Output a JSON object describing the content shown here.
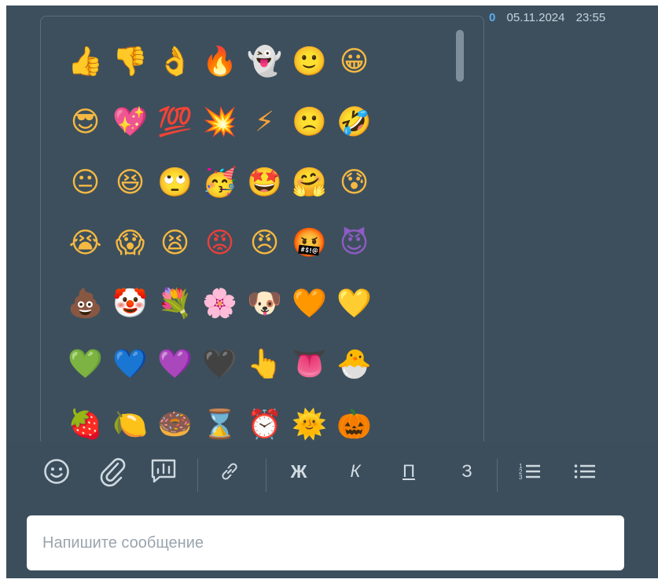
{
  "meta": {
    "count": "0",
    "date": "05.11.2024",
    "time": "23:55"
  },
  "picker": {
    "rows": [
      [
        {
          "name": "thumbs-up",
          "char": "👍",
          "color": "#f5b942"
        },
        {
          "name": "thumbs-down",
          "char": "👎",
          "color": "#f5b942"
        },
        {
          "name": "ok-hand",
          "char": "👌",
          "color": "#f5b942"
        },
        {
          "name": "fire",
          "char": "🔥",
          "color": "#f36b2c"
        },
        {
          "name": "ghost",
          "char": "👻",
          "color": "#f0f0f0"
        },
        {
          "name": "slightly-smiling-face",
          "char": "🙂",
          "color": "#f5b942"
        },
        {
          "name": "grinning-face",
          "char": "😀",
          "color": "#f5b942"
        }
      ],
      [
        {
          "name": "smiling-face-with-sunglasses",
          "char": "😎",
          "color": "#f5b942"
        },
        {
          "name": "sparkling-heart",
          "char": "💖",
          "color": "#f27aa6"
        },
        {
          "name": "hundred-points",
          "char": "💯",
          "color": "#e0303a"
        },
        {
          "name": "collision",
          "char": "💥",
          "color": "#f04b3a"
        },
        {
          "name": "high-voltage",
          "char": "⚡",
          "color": "#f3a13a"
        },
        {
          "name": "slightly-frowning-face",
          "char": "🙁",
          "color": "#f5b942"
        },
        {
          "name": "rolling-on-the-floor-laughing",
          "char": "🤣",
          "color": "#f5b942"
        }
      ],
      [
        {
          "name": "neutral-face",
          "char": "😐",
          "color": "#f5b942"
        },
        {
          "name": "grinning-squinting-face",
          "char": "😆",
          "color": "#f5b942"
        },
        {
          "name": "face-with-rolling-eyes",
          "char": "🙄",
          "color": "#f5b942"
        },
        {
          "name": "partying-face",
          "char": "🥳",
          "color": "#f5b942"
        },
        {
          "name": "star-struck",
          "char": "🤩",
          "color": "#f5b942"
        },
        {
          "name": "hugging-face",
          "char": "🤗",
          "color": "#f5b942"
        },
        {
          "name": "anxious-face-with-sweat",
          "char": "😰",
          "color": "#f5b942"
        }
      ],
      [
        {
          "name": "loudly-crying-face",
          "char": "😭",
          "color": "#f5b942"
        },
        {
          "name": "face-screaming-in-fear",
          "char": "😱",
          "color": "#f5b942"
        },
        {
          "name": "tired-face",
          "char": "😫",
          "color": "#f5b942"
        },
        {
          "name": "enraged-face",
          "char": "😡",
          "color": "#e8403a"
        },
        {
          "name": "angry-face",
          "char": "😠",
          "color": "#f5b942"
        },
        {
          "name": "face-with-symbols-on-mouth",
          "char": "🤬",
          "color": "#e8403a"
        },
        {
          "name": "smiling-face-with-horns",
          "char": "😈",
          "color": "#8e5cc4"
        }
      ],
      [
        {
          "name": "pile-of-poo",
          "char": "💩",
          "color": "#8a5a3c"
        },
        {
          "name": "clown-face",
          "char": "🤡",
          "color": "#f0f0f0"
        },
        {
          "name": "bouquet",
          "char": "💐",
          "color": "#6bbf4a"
        },
        {
          "name": "cherry-blossom",
          "char": "🌸",
          "color": "#f5a8c8"
        },
        {
          "name": "dog-face",
          "char": "🐶",
          "color": "#c88a4a"
        },
        {
          "name": "orange-heart",
          "char": "🧡",
          "color": "#f07a2a"
        },
        {
          "name": "yellow-heart",
          "char": "💛",
          "color": "#f5c43a"
        }
      ],
      [
        {
          "name": "green-heart",
          "char": "💚",
          "color": "#2fbf6a"
        },
        {
          "name": "blue-heart",
          "char": "💙",
          "color": "#2f7fd6"
        },
        {
          "name": "purple-heart",
          "char": "💜",
          "color": "#8a5cd6"
        },
        {
          "name": "black-heart",
          "char": "🖤",
          "color": "#1a1a1a"
        },
        {
          "name": "backhand-index-pointing-up",
          "char": "👆",
          "color": "#f5b942"
        },
        {
          "name": "tongue",
          "char": "👅",
          "color": "#e0406a"
        },
        {
          "name": "hatching-chick",
          "char": "🐣",
          "color": "#f5d84a"
        }
      ],
      [
        {
          "name": "strawberry",
          "char": "🍓",
          "color": "#e0303a"
        },
        {
          "name": "lemon",
          "char": "🍋",
          "color": "#f5d02a"
        },
        {
          "name": "doughnut",
          "char": "🍩",
          "color": "#c07a4a"
        },
        {
          "name": "hourglass",
          "char": "⌛",
          "color": "#5a9ad6"
        },
        {
          "name": "alarm-clock",
          "char": "⏰",
          "color": "#e0403a"
        },
        {
          "name": "sun-with-face",
          "char": "🌞",
          "color": "#f5b942"
        },
        {
          "name": "jack-o-lantern",
          "char": "🎃",
          "color": "#f07a2a"
        }
      ]
    ]
  },
  "composer": {
    "placeholder": "Напишите сообщение",
    "format": {
      "bold": "Ж",
      "italic": "К",
      "underline": "П",
      "strike": "З"
    }
  },
  "colors": {
    "background": "#3c4e5c",
    "accent": "#5aaef0"
  }
}
